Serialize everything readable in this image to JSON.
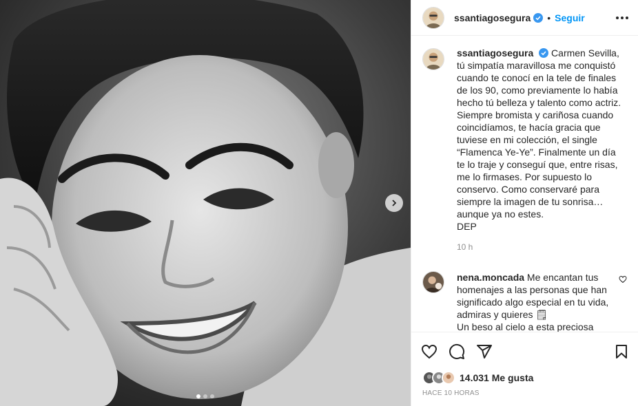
{
  "post": {
    "username": "ssantiagosegura",
    "follow_label": "Seguir",
    "separator": "•",
    "photo_alt": "Carmen Sevilla",
    "caption_text": "Carmen Sevilla, tú simpatía maravillosa me conquistó cuando te conocí en la tele de finales de los 90, como previamente lo había hecho tú belleza y talento como actriz. Siempre bromista y cariñosa cuando coincidíamos, te hacía gracia que tuviese en mi colección, el single “Flamenca Ye-Ye”. Finalmente un día te lo traje y conseguí que, entre risas, me lo firmases. Por supuesto lo conservo. Como conservaré para siempre la imagen de tu sonrisa… aunque ya no estes.",
    "caption_end": "DEP",
    "caption_time": "10 h",
    "comment": {
      "username": "nena.moncada",
      "text": "Me encantan tus homenajes a las personas que han significado algo especial en tu vida, admiras y quieres 🗒",
      "text2": "Un beso al cielo a esta preciosa"
    },
    "likes": "14.031 Me gusta",
    "posted": "HACE 10 HORAS",
    "carousel": {
      "count": 3,
      "active": 0
    },
    "colors": {
      "accent": "#0095f6",
      "verified": "#3897f0",
      "muted": "#8e8e8e",
      "border": "#efefef"
    },
    "icons": [
      "verified-icon",
      "more-icon",
      "chevron-right-icon",
      "heart-icon",
      "comment-icon",
      "share-icon",
      "bookmark-icon"
    ]
  }
}
